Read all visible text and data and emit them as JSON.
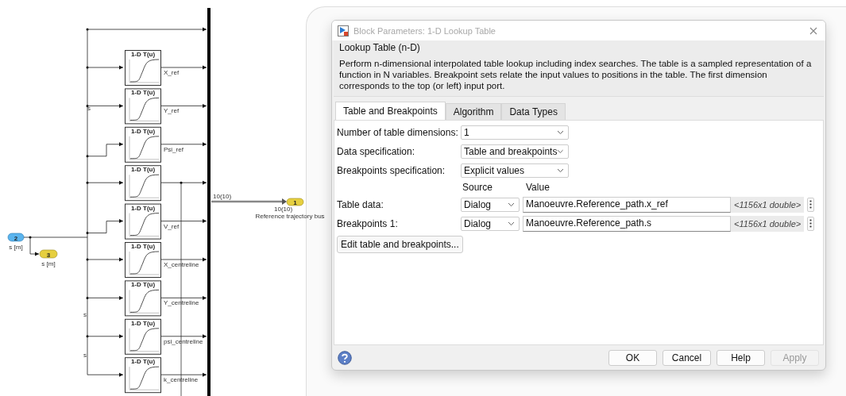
{
  "diagram": {
    "lookup_blocks": [
      {
        "title": "1-D T(u)",
        "output_label": "X_ref"
      },
      {
        "title": "1-D T(u)",
        "output_label": "Y_ref"
      },
      {
        "title": "1-D T(u)",
        "output_label": "Psi_ref"
      },
      {
        "title": "1-D T(u)"
      },
      {
        "title": "1-D T(u)",
        "output_label": "V_ref"
      },
      {
        "title": "1-D T(u)",
        "output_label": "X_centreline"
      },
      {
        "title": "1-D T(u)",
        "output_label": "Y_centreline"
      },
      {
        "title": "1-D T(u)",
        "output_label": "psi_centreline"
      },
      {
        "title": "1-D T(u)",
        "output_label": "k_centreline"
      }
    ],
    "input_port": {
      "number": "2",
      "label": "s [m]"
    },
    "s_output_port": {
      "number": "3",
      "label": "s [m]"
    },
    "bus_output_port": {
      "number": "1",
      "label": "Reference trajectory bus"
    },
    "bus_signal_labels": [
      "10(10)",
      "10(10)"
    ],
    "line_labels": [
      "s",
      "s",
      "s"
    ]
  },
  "dialog": {
    "title": "Block Parameters: 1-D Lookup Table",
    "group_title": "Lookup Table (n-D)",
    "description": "Perform n-dimensional interpolated table lookup including index searches. The table is a sampled representation of a function in N variables. Breakpoint sets relate the input values to positions in the table. The first dimension corresponds to the top (or left) input port.",
    "tabs": [
      {
        "label": "Table and Breakpoints",
        "selected": true
      },
      {
        "label": "Algorithm",
        "selected": false
      },
      {
        "label": "Data Types",
        "selected": false
      }
    ],
    "settings": [
      {
        "label": "Number of table dimensions:",
        "value": "1"
      },
      {
        "label": "Data specification:",
        "value": "Table and breakpoints"
      },
      {
        "label": "Breakpoints specification:",
        "value": "Explicit values"
      }
    ],
    "columns": [
      "Source",
      "Value"
    ],
    "parameters": [
      {
        "label": "Table data:",
        "source": "Dialog",
        "value": "Manoeuvre.Reference_path.x_ref",
        "size": "<1156x1 double>"
      },
      {
        "label": "Breakpoints 1:",
        "source": "Dialog",
        "value": "Manoeuvre.Reference_path.s",
        "size": "<1156x1 double>"
      }
    ],
    "edit_button": "Edit table and breakpoints...",
    "buttons": [
      {
        "label": "OK",
        "disabled": false
      },
      {
        "label": "Cancel",
        "disabled": false
      },
      {
        "label": "Help",
        "disabled": false
      },
      {
        "label": "Apply",
        "disabled": true
      }
    ]
  }
}
